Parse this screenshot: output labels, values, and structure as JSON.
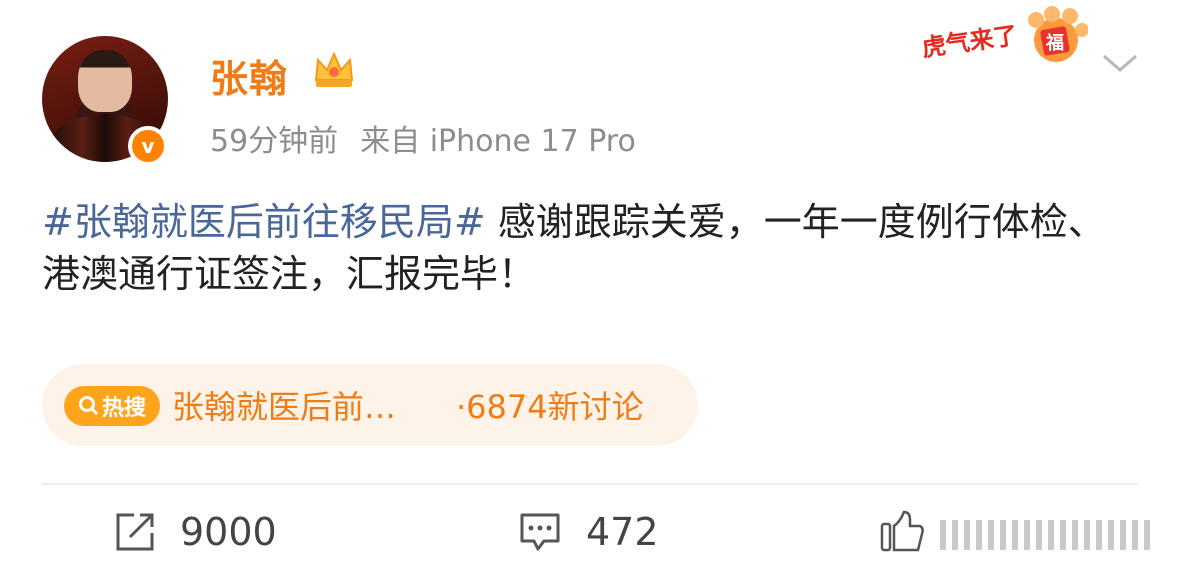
{
  "post": {
    "username": "张翰",
    "time": "59分钟前",
    "source": "来自 iPhone 17 Pro",
    "hashtag": "#张翰就医后前往移民局#",
    "text": " 感谢跟踪关爱，一年一度例行体检、港澳通行证签注，汇报完毕！"
  },
  "hot_search": {
    "tag_label": "热搜",
    "title": "张翰就医后前…",
    "count": "·6874新讨论"
  },
  "actions": {
    "repost_count": "9000",
    "comment_count": "472"
  },
  "badge": {
    "text": "虎气来了",
    "stamp": "福"
  },
  "colors": {
    "accent": "#f07c16",
    "hashtag": "#4a6799",
    "hot_bg": "#fdf3e8"
  }
}
